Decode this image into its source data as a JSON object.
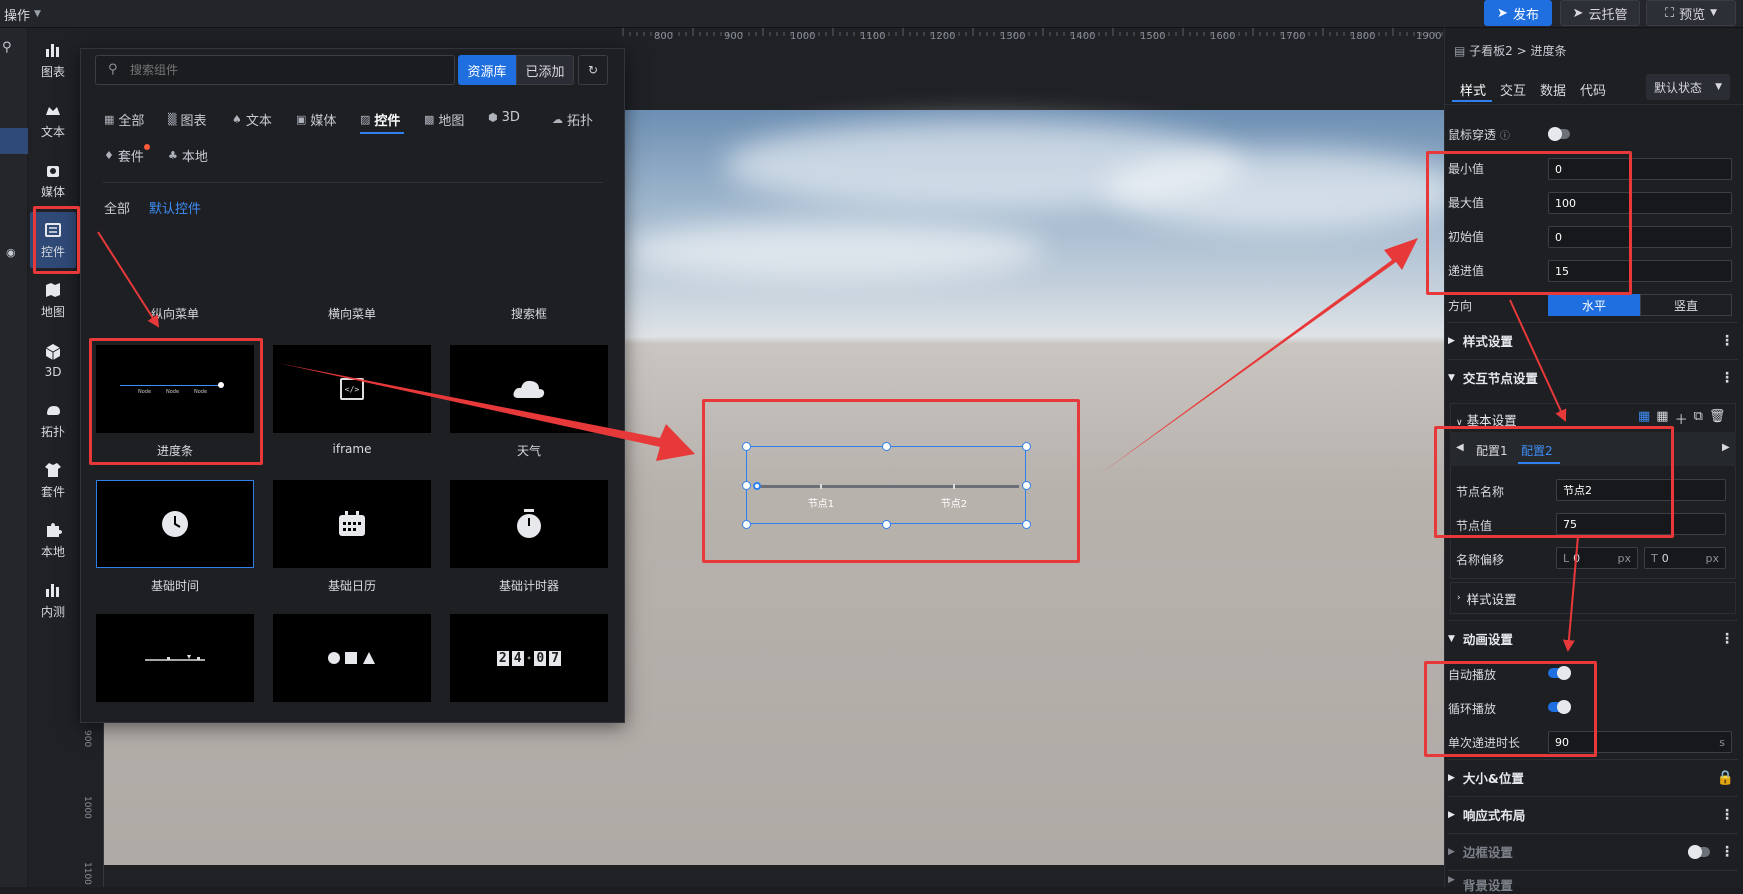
{
  "topbar": {
    "menu_label": "操作",
    "publish": "发布",
    "cloud": "云托管",
    "preview": "预览"
  },
  "rail": [
    {
      "label": "图表",
      "icon": "bar-chart-icon"
    },
    {
      "label": "文本",
      "icon": "text-icon"
    },
    {
      "label": "媒体",
      "icon": "media-icon"
    },
    {
      "label": "控件",
      "icon": "widget-icon"
    },
    {
      "label": "地图",
      "icon": "map-icon"
    },
    {
      "label": "3D",
      "icon": "cube-icon"
    },
    {
      "label": "拓扑",
      "icon": "topology-icon"
    },
    {
      "label": "套件",
      "icon": "shirt-icon"
    },
    {
      "label": "本地",
      "icon": "puzzle-icon"
    },
    {
      "label": "内测",
      "icon": "beta-chart-icon"
    }
  ],
  "ruler": {
    "top": [
      "800",
      "900",
      "1000",
      "1100",
      "1200",
      "1300",
      "1400",
      "1500",
      "1600",
      "1700",
      "1800",
      "1900"
    ],
    "left": [
      "900",
      "1000",
      "1100"
    ]
  },
  "panel": {
    "search_placeholder": "搜索组件",
    "lib_btn": "资源库",
    "added_btn": "已添加",
    "categories": [
      "全部",
      "图表",
      "文本",
      "媒体",
      "控件",
      "地图",
      "3D",
      "拓扑",
      "套件",
      "本地"
    ],
    "sub_all": "全部",
    "sub_default": "默认控件",
    "row0": [
      "纵向菜单",
      "横向菜单",
      "搜索框"
    ],
    "cards": [
      "进度条",
      "iframe",
      "天气",
      "基础时间",
      "基础日历",
      "基础计时器"
    ],
    "thumb_iframe": "</>",
    "thumb_progress_nodes": [
      "Node",
      "Node",
      "Node"
    ],
    "thumb_counter": [
      "2",
      "4",
      "0",
      "7"
    ]
  },
  "canvas": {
    "node1": "节点1",
    "node2": "节点2"
  },
  "right": {
    "crumb": "子看板2 > 进度条",
    "tabs": [
      "样式",
      "交互",
      "数据",
      "代码"
    ],
    "state": "默认状态",
    "mouse_through": "鼠标穿透",
    "fields": [
      {
        "label": "最小值",
        "value": "0"
      },
      {
        "label": "最大值",
        "value": "100"
      },
      {
        "label": "初始值",
        "value": "0"
      },
      {
        "label": "递进值",
        "value": "15"
      }
    ],
    "direction": "方向",
    "dir_h": "水平",
    "dir_v": "竖直",
    "style_settings": "样式设置",
    "node_settings": "交互节点设置",
    "basic_settings": "基本设置",
    "config1": "配置1",
    "config2": "配置2",
    "node_name_label": "节点名称",
    "node_name": "节点2",
    "node_value_label": "节点值",
    "node_value": "75",
    "name_offset": "名称偏移",
    "offset_l": "L",
    "offset_l_val": "0",
    "offset_t": "T",
    "offset_t_val": "0",
    "px": "px",
    "sub_style": "样式设置",
    "anim": "动画设置",
    "autoplay": "自动播放",
    "loop": "循环播放",
    "step_duration": "单次递进时长",
    "step_duration_val": "90",
    "unit_s": "s",
    "size_pos": "大小&位置",
    "responsive": "响应式布局",
    "border": "边框设置",
    "bg": "背景设置"
  }
}
